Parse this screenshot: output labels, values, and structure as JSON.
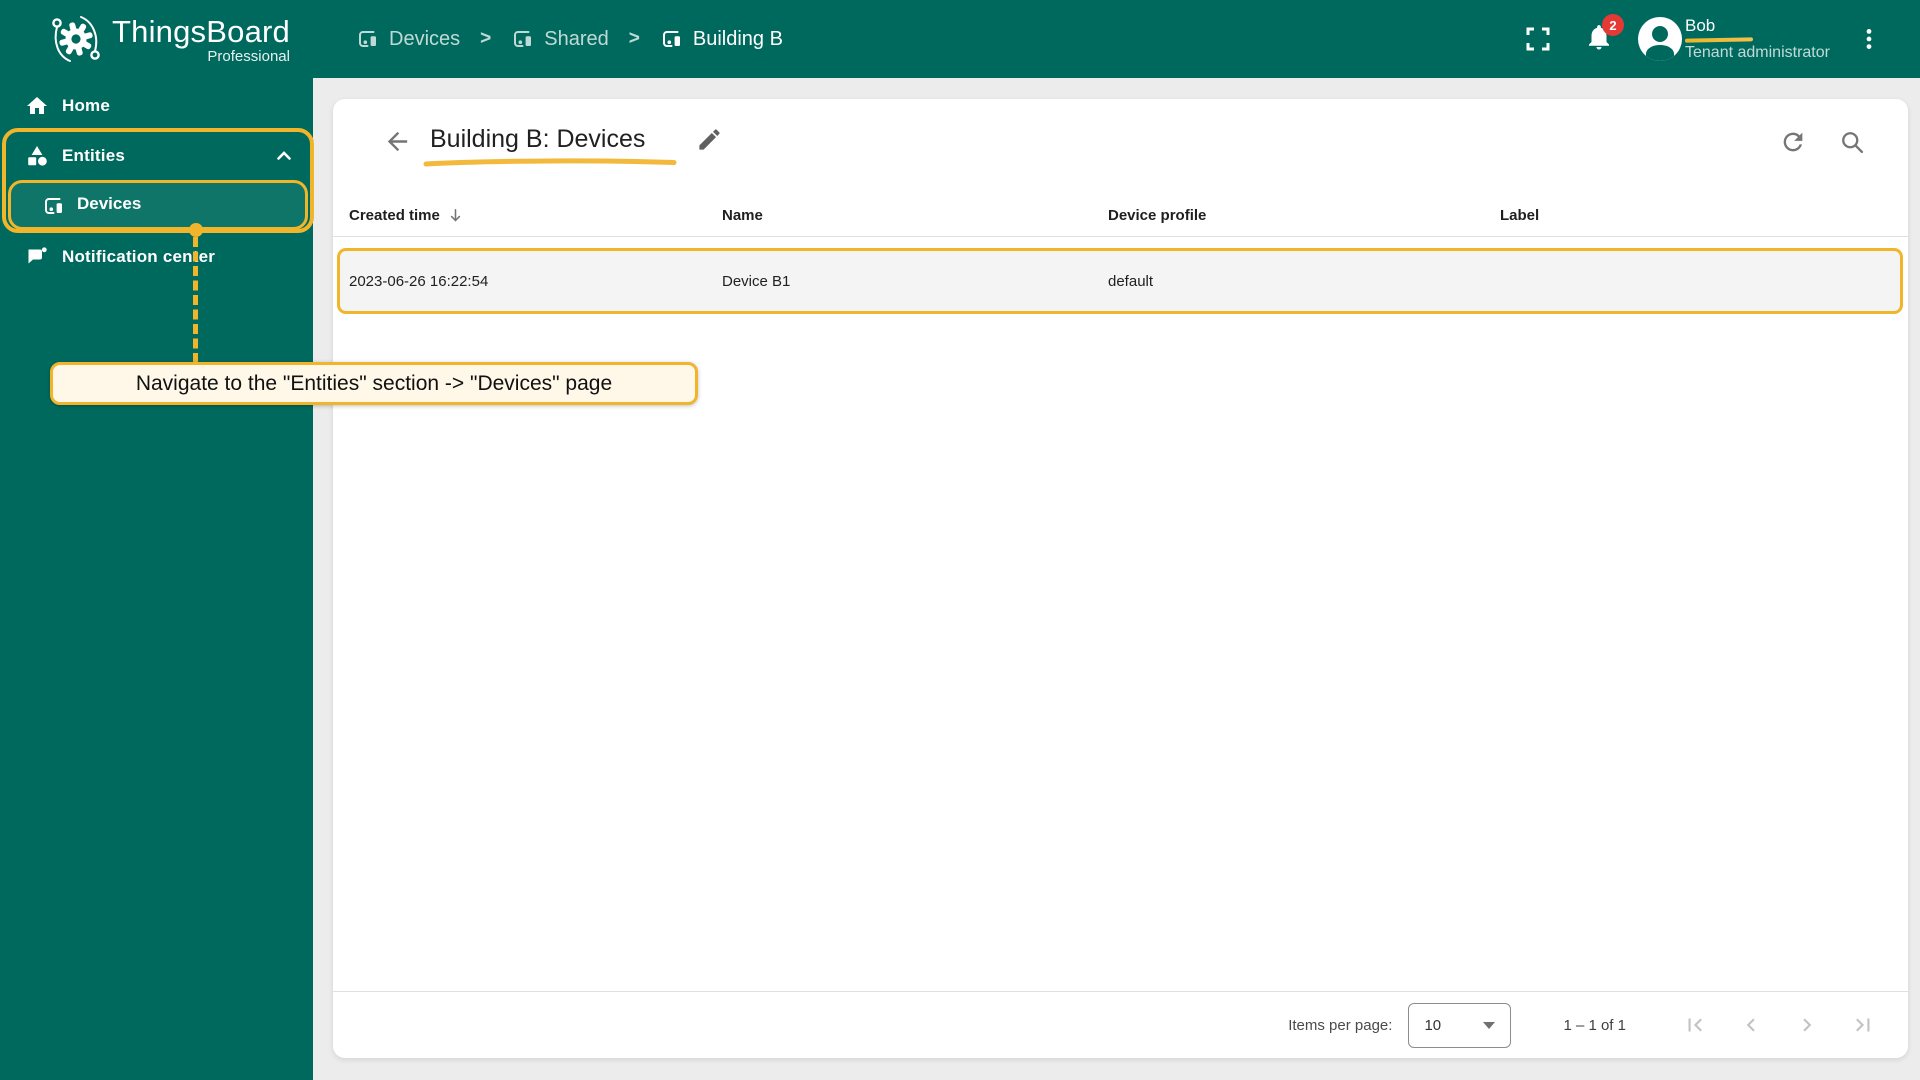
{
  "app": {
    "name": "ThingsBoard",
    "edition": "Professional"
  },
  "topbar": {
    "breadcrumb": [
      {
        "label": "Devices"
      },
      {
        "label": "Shared"
      },
      {
        "label": "Building B"
      }
    ],
    "breadcrumb_separator": ">",
    "notification_count": "2",
    "user": {
      "name": "Bob",
      "role": "Tenant administrator"
    }
  },
  "sidebar": {
    "items": [
      {
        "label": "Home"
      },
      {
        "label": "Entities"
      },
      {
        "label": "Devices"
      },
      {
        "label": "Notification center"
      }
    ]
  },
  "page": {
    "title": "Building B: Devices"
  },
  "table": {
    "columns": [
      "Created time",
      "Name",
      "Device profile",
      "Label"
    ],
    "sort_column": "Created time",
    "sort_direction": "desc",
    "rows": [
      {
        "created_time": "2023-06-26 16:22:54",
        "name": "Device B1",
        "device_profile": "default",
        "label": ""
      }
    ]
  },
  "pagination": {
    "items_per_page_label": "Items per page:",
    "items_per_page": "10",
    "range": "1 – 1 of 1"
  },
  "annotation": {
    "tooltip_text": "Navigate to the \"Entities\" section -> \"Devices\" page"
  },
  "colors": {
    "primary_teal": "#00695e",
    "active_item_teal": "#0e7568",
    "annotation_yellow": "#f0b52b",
    "tooltip_bg": "#fff8e8",
    "badge_red": "#e53935",
    "row_bg": "#f4f4f4",
    "card_bg": "#ffffff",
    "page_bg": "#ececec"
  },
  "icons": {
    "logo": "gear-bug-with-orbit",
    "breadcrumb-entity": "devices-other",
    "fullscreen": "corner-brackets",
    "notifications": "bell",
    "avatar": "person-circle",
    "menu": "more-vert",
    "home": "house",
    "entities": "category-shapes",
    "devices": "devices-other",
    "notification-center": "chat-bubble-dot",
    "expand": "chevron-up",
    "back": "arrow-left",
    "edit": "pencil",
    "refresh": "refresh-arrow",
    "search": "magnifier",
    "sort": "arrow-down",
    "dropdown": "triangle-down",
    "pager": [
      "first-page",
      "chevron-left",
      "chevron-right",
      "last-page"
    ]
  }
}
